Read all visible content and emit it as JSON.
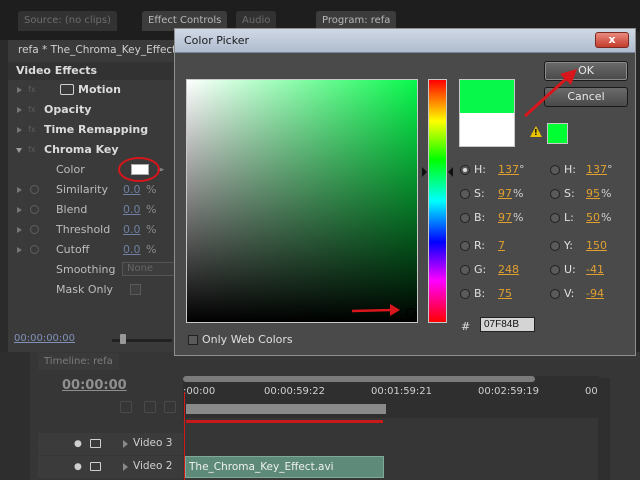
{
  "top_tabs": [
    {
      "label": "Source: (no clips)"
    },
    {
      "label": "Effect Controls"
    },
    {
      "label": "Audio"
    },
    {
      "label": "Program: refa"
    }
  ],
  "effect_controls": {
    "clip_label": "refa * The_Chroma_Key_Effect.avi",
    "header": "Video Effects",
    "effects": {
      "motion": "Motion",
      "opacity": "Opacity",
      "time_remapping": "Time Remapping",
      "chroma_key": "Chroma Key"
    },
    "props": {
      "color": "Color",
      "similarity": {
        "label": "Similarity",
        "value": "0.0",
        "unit": "%"
      },
      "blend": {
        "label": "Blend",
        "value": "0.0",
        "unit": "%"
      },
      "threshold": {
        "label": "Threshold",
        "value": "0.0",
        "unit": "%"
      },
      "cutoff": {
        "label": "Cutoff",
        "value": "0.0",
        "unit": "%"
      },
      "smoothing": {
        "label": "Smoothing",
        "value": "None"
      },
      "mask_only": "Mask Only"
    },
    "timecode": "00:00:00:00",
    "color_value": "#ffffff"
  },
  "timeline": {
    "tab": "Timeline: refa",
    "timecode": "00:00:00",
    "ticks": [
      ":00:00",
      "00:00:59:22",
      "00:01:59:21",
      "00:02:59:19",
      "00"
    ],
    "tracks": [
      {
        "name": "Video 3"
      },
      {
        "name": "Video 2"
      }
    ],
    "clip": "The_Chroma_Key_Effect.avi"
  },
  "color_picker": {
    "title": "Color Picker",
    "close": "x",
    "ok": "OK",
    "cancel": "Cancel",
    "only_web_colors": "Only Web Colors",
    "hex": "07F84B",
    "new_color": "#07f84b",
    "old_color": "#ffffff",
    "hsb": {
      "h": "137",
      "h_unit": "°",
      "s": "97",
      "s_unit": "%",
      "b": "97",
      "b_unit": "%"
    },
    "hsl": {
      "h": "137",
      "h_unit": "°",
      "s": "95",
      "s_unit": "%",
      "l": "50",
      "l_unit": "%"
    },
    "rgb": {
      "r": "7",
      "g": "248",
      "b": "75"
    },
    "yuv": {
      "y": "150",
      "u": "-41",
      "v": "-94"
    },
    "labels": {
      "h": "H:",
      "s": "S:",
      "b": "B:",
      "r": "R:",
      "g": "G:",
      "bb": "B:",
      "l": "L:",
      "y": "Y:",
      "u": "U:",
      "v": "V:",
      "hash": "#"
    }
  },
  "colors": {
    "accent_red": "#d8161b",
    "value_orange": "#e0a030"
  }
}
